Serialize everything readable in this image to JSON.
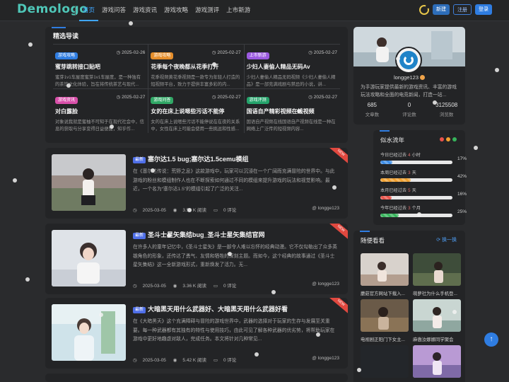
{
  "header": {
    "logo": "Demologo",
    "nav": [
      "首页",
      "游戏问答",
      "游戏资讯",
      "游戏攻略",
      "游戏测评",
      "上市新游"
    ],
    "btn_new": "新建",
    "btn_login": "注册",
    "btn_register": "登录"
  },
  "featured": {
    "title": "精选导读",
    "items": [
      {
        "tag": "游戏攻略",
        "tag_color": "#2f7de1",
        "date": "2025-02-26",
        "title": "蜜芽跳转接口贴吧",
        "desc": "蜜芽1v1车屋度蜜芽1v1车屋度，是一种独有的茶饮文化体验，旨在将传统茶艺与现代..."
      },
      {
        "tag": "游戏攻略",
        "tag_color": "#e58e2b",
        "date": "2025-02-27",
        "title": "花季每个夜晚都从花季打开",
        "desc": "花季视频黄花季视频是一款专为年轻人打造的短视频平台，致力于提供丰富多彩的内..."
      },
      {
        "tag": "上市新游",
        "tag_color": "#9b5ae0",
        "date": "2025-02-27",
        "title": "少妇人妻偷人精品无码Av",
        "desc": "少妇人妻偷人精品无码视频《少妇人妻偷人精品》是一部充满戏剧与禁忌的小说，讲..."
      },
      {
        "tag": "游戏资讯",
        "tag_color": "#d84fa9",
        "date": "2025-02-27",
        "title": "对白露脸",
        "desc": "对象说我就是蜜柚不可知于在现代社会中，信息的获取与分享变得日益便捷，知乎作..."
      },
      {
        "tag": "游戏问答",
        "tag_color": "#31a866",
        "date": "2025-02-27",
        "title": "女的在床上说嗯些污话不能停",
        "desc": "女的在床上说嗯些污话不能停说在在夜的关系中，女性在床上可能会使用一些挑逗和性感..."
      },
      {
        "tag": "游戏评测",
        "tag_color": "#25a36b",
        "date": "2025-02-27",
        "title": "国语自产精彩视频在线视频",
        "desc": "国语自产视频在线国语自产视频在线是一种在网络上广泛传的短视频内容..."
      }
    ]
  },
  "articles": [
    {
      "badge": "最新",
      "title": "塞尔达1.5 bug;塞尔达1.5cemu模组",
      "excerpt": "在《塞尔达传说：荒野之息》这款游戏中，玩家可以沉浸在一个广阔而充满冒险的世界中。与此游戏的粉丝和模组制作人也在不断探索如何通过不同的模组来提升游戏的玩法和视觉影响。最近，一个名为“塞尔达1.5”的模组引起了广泛的关注...",
      "date": "2025-03-05",
      "views": "3.53 K 阅读",
      "comments": "0 评论",
      "author": "longge123",
      "ribbon": "NEW"
    },
    {
      "badge": "最新",
      "title": "圣斗士星矢集结bug_圣斗士星矢集结官网",
      "excerpt": "在许多人的童年记忆中，《圣斗士星矢》是一部令人难以忘怀的经典动漫。它不仅勾勒出了众多英雄角色的形象，还传达了勇气、友情和牺牲的深刻主题。而如今，这个经典的故事通过《圣斗士星矢集结》这一全新游戏形式，重新焕发了活力。无...",
      "date": "2025-03-05",
      "views": "3.36 K 阅读",
      "comments": "0 评论",
      "author": "longge123",
      "ribbon": "NEW"
    },
    {
      "badge": "最新",
      "title": "大暗黑天用什么武器好、大暗黑天用什么武器好看",
      "excerpt": "在《大暗黑天》这个充满障碍与冒险的游戏世界中，武器的选择对于玩家的生存与发展至关重要。每一种武器都有其独有的特性与使用技巧，由此可见了解各种武器的优劣势，将帮助玩家在游戏中更好地趣虐对敌人，完成任务。本文将针对几种常见...",
      "date": "2025-03-05",
      "views": "5.42 K 阅读",
      "comments": "0 评论",
      "author": "longge123",
      "ribbon": "NEW"
    }
  ],
  "profile": {
    "name": "longge123",
    "desc": "为手游玩家提供最新的游戏资讯、丰富的游戏玩法攻略和全面的电竞新闻，打造一站...",
    "stats": [
      {
        "num": "685",
        "label": "文章数"
      },
      {
        "num": "0",
        "label": "评论数"
      },
      {
        "num": "3125508",
        "label": "浏览数"
      }
    ]
  },
  "flow": {
    "title": "似水流年",
    "dot_colors": [
      "#e8534a",
      "#f0a030",
      "#36b35b"
    ],
    "rows": [
      {
        "prefix": "今日已经过去",
        "num": "4",
        "unit": "小时",
        "percent": 17,
        "pct_label": "17%",
        "color": "#3d8de6"
      },
      {
        "prefix": "本周已经过去",
        "num": "3",
        "unit": "天",
        "percent": 42,
        "pct_label": "42%",
        "color": "#f0a030"
      },
      {
        "prefix": "本月已经过去",
        "num": "5",
        "unit": "天",
        "percent": 16,
        "pct_label": "16%",
        "color": "#e8534a"
      },
      {
        "prefix": "今年已经过去",
        "num": "3",
        "unit": "个月",
        "percent": 25,
        "pct_label": "25%",
        "color": "#36b35b"
      }
    ]
  },
  "random": {
    "title": "随便看看",
    "refresh": "换一换",
    "items": [
      {
        "caption": "蘑菇官方网站下载入..."
      },
      {
        "caption": "萌萝社为什么手机登..."
      },
      {
        "caption": "电视剧正阳门下女主..."
      },
      {
        "caption": "麻傲汝娜娜同学聚会"
      },
      {
        "caption": ""
      },
      {
        "caption": ""
      }
    ]
  }
}
